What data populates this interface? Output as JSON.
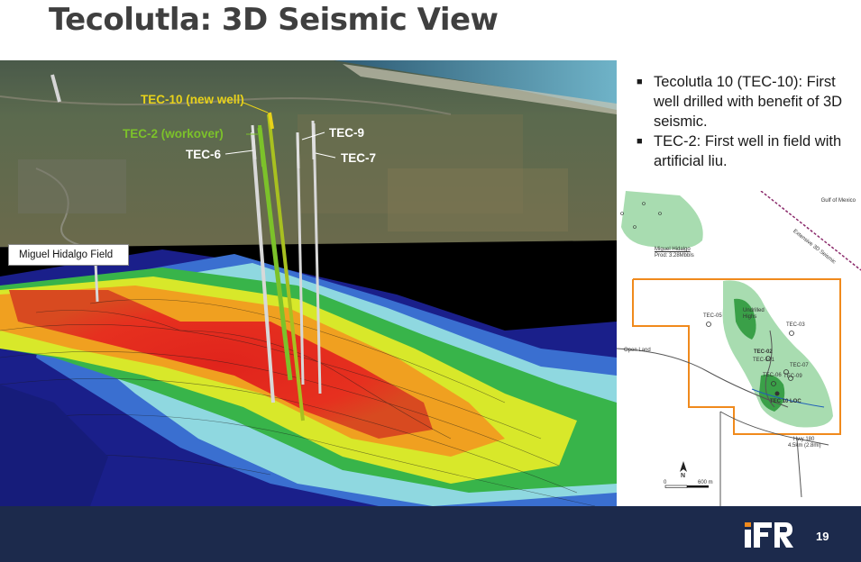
{
  "slide": {
    "title": "Tecolutla: 3D Seismic View",
    "page_number": "19"
  },
  "seismic_view": {
    "well_labels": {
      "tec10": "TEC-10 (new well)",
      "tec2": "TEC-2 (workover)",
      "tec6": "TEC-6",
      "tec9": "TEC-9",
      "tec7": "TEC-7"
    },
    "field_label": "Miguel Hidalgo Field",
    "colors": {
      "tec10": "#e8d21a",
      "tec2": "#7cc22a",
      "white_label": "#ffffff"
    }
  },
  "bullets": [
    "Tecolutla 10 (TEC-10): First well drilled with benefit of 3D seismic.",
    "TEC-2: First well in  field with artificial liu."
  ],
  "location_map": {
    "gulf_label": "Gulf of Mexico",
    "seismic_label": "Extensive 3D Seismic",
    "field_name": "Miguel Hidalgo",
    "field_prod": "Prod: 3.28Mbbls",
    "undrilled": "Undrilled Highs",
    "open_land": "Open Land",
    "wells": [
      "TEC-05",
      "TEC-03",
      "TEC-02",
      "TEC-101",
      "TEC-07",
      "TEC-06",
      "TEC-09",
      "TEC 10 LOC"
    ],
    "hwy": "Hwy 180",
    "hwy_dist": "4.5km (2.8mi)",
    "north": "N",
    "scale_start": "0",
    "scale_end": "600 m"
  },
  "footer": {
    "logo": "iFR"
  }
}
